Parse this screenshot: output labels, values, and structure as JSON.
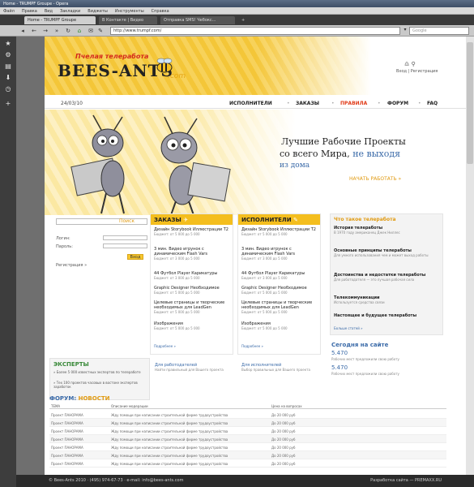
{
  "window": {
    "title": "Home - TRUMPF Groupe - Opera"
  },
  "menu": [
    "Файл",
    "Правка",
    "Вид",
    "Закладки",
    "Виджеты",
    "Инструменты",
    "Справка"
  ],
  "tabs": [
    {
      "label": "Home - TRUMPF Groupe"
    },
    {
      "label": "В Контакте | Видео"
    },
    {
      "label": "Отправка SMS! Чебокс..."
    }
  ],
  "address": {
    "url": "http://www.trumpf.com/",
    "search_placeholder": "Google"
  },
  "site": {
    "logo_small": "Пчелая телеработа",
    "logo_big": "BEES-ANTS",
    "logo_com": ".com",
    "util_icons": "♎ ⚲",
    "util_links": "Вход | Регистрация",
    "date": "24/03/10",
    "nav": [
      {
        "label": "ИСПОЛНИТЕЛИ",
        "active": false
      },
      {
        "label": "ЗАКАЗЫ",
        "active": false
      },
      {
        "label": "ПРАВИЛА",
        "active": true
      },
      {
        "label": "ФОРУМ",
        "active": false
      },
      {
        "label": "FAQ",
        "active": false
      }
    ],
    "hero": {
      "line1": "Лучшие Рабочие Проекты",
      "line2_a": "со всего Мира, ",
      "line2_b": "не выходя",
      "line3": "из дома",
      "cta": "НАЧАТЬ РАБОТАТЬ »"
    },
    "login": {
      "search_btn": "Поиск",
      "login_label": "Логин:",
      "password_label": "Пароль:",
      "submit": "Вход",
      "register": "Регистрация »"
    },
    "orders": {
      "title": "ЗАКАЗЫ",
      "items": [
        {
          "title": "Дизайн Storybook Иллюстрации Т2",
          "sub": "Бюджет: от 5 000 до 5 000"
        },
        {
          "title": "3 мин. Видео игрунок с динамическим Flash Vars",
          "sub": "Бюджет: от 3 000 до 5 000"
        },
        {
          "title": "44 Футбол Player Карикатуры",
          "sub": "Бюджет: от 3 000 до 5 000"
        },
        {
          "title": "Graphic Designer Необходимое",
          "sub": "Бюджет: от 5 000 до 5 000"
        },
        {
          "title": "Целевые страницы и творческие необходимых для LeadGen",
          "sub": "Бюджет: от 5 000 до 5 000"
        },
        {
          "title": "Изображения",
          "sub": "Бюджет: от 5 000 до 5 000"
        }
      ],
      "more": "Подробнее »"
    },
    "performers": {
      "title": "ИСПОЛНИТЕЛИ",
      "items": [
        {
          "title": "Дизайн Storybook Иллюстрации Т2",
          "sub": "Бюджет: от 5 000 до 5 000"
        },
        {
          "title": "3 мин. Видео игрунок с динамическим Flash Vars",
          "sub": "Бюджет: от 3 000 до 5 000"
        },
        {
          "title": "44 Футбол Player Карикатуры",
          "sub": "Бюджет: от 3 000 до 5 000"
        },
        {
          "title": "Graphic Designer Необходимое",
          "sub": "Бюджет: от 5 000 до 5 000"
        },
        {
          "title": "Целевые страницы и творческие необходимых для LeadGen",
          "sub": "Бюджет: от 5 000 до 5 000"
        },
        {
          "title": "Изображения",
          "sub": "Бюджет: от 5 000 до 5 000"
        }
      ],
      "more": "Подробнее »"
    },
    "telework": {
      "title": "Что такое телеработа",
      "items": [
        {
          "title": "История телеработы",
          "sub": "В 1970 году американец Джек Ниллес"
        },
        {
          "title": "Основные принципы телеработы",
          "sub": "Для умного использования чем и может выход работы"
        },
        {
          "title": "Достоинства и недостатки телеработы",
          "sub": "Для работодателя — это лучшая рабочая сила"
        },
        {
          "title": "Телекоммуникации",
          "sub": "Используется средства связи"
        },
        {
          "title": "Настоящее и будущее телеработы",
          "sub": ""
        }
      ],
      "more": "Больше статей »"
    },
    "today": {
      "title": "Сегодня на сайте",
      "stats": [
        {
          "num": "5.470",
          "text": "Рабочих мест предложили свою работу"
        },
        {
          "num": "5.470",
          "text": "Рабочих мест предложили свою работу"
        }
      ]
    },
    "experts": {
      "title": "ЭКСПЕРТЫ",
      "line1": "» Более 5 000 известных экспертов по телеработе",
      "line2": "» Тех 100 проектов часовых в востоке экспертов заработок"
    },
    "for_employers": {
      "title": "Для работодателей",
      "sub": "Найти правильный для Вашего проекта"
    },
    "for_performers": {
      "title": "Для исполнителей",
      "sub": "Выбор правильных для Вашего проекта"
    },
    "forum": {
      "title_a": "ФОРУМ: ",
      "title_b": "НОВОСТИ",
      "headers": [
        "ТЕМА",
        "Описание модерации",
        "Цена на вопросах"
      ],
      "rows": [
        [
          "Проект ПАНОРАМА",
          "Жду помощи при написании строительной фирме трудоустройства",
          "До 20 000 руб"
        ],
        [
          "Проект ПАНОРАМА",
          "Жду помощи при написании строительной фирме трудоустройства",
          "До 20 000 руб"
        ],
        [
          "Проект ПАНОРАМА",
          "Жду помощи при написании строительной фирме трудоустройства",
          "До 20 000 руб"
        ],
        [
          "Проект ПАНОРАМА",
          "Жду помощи при написании строительной фирме трудоустройства",
          "До 20 000 руб"
        ],
        [
          "Проект ПАНОРАМА",
          "Жду помощи при написании строительной фирме трудоустройства",
          "До 20 000 руб"
        ],
        [
          "Проект ПАНОРАМА",
          "Жду помощи при написании строительной фирме трудоустройства",
          "До 20 000 руб"
        ],
        [
          "Проект ПАНОРАМА",
          "Жду помощи при написании строительной фирме трудоустройства",
          "До 20 000 руб"
        ]
      ]
    }
  },
  "status": {
    "left": "© Bees-Ants 2010 · (495) 974-67-73 · e-mail: info@bees-ants.com",
    "right": "Разработка сайта — PREMAXX.RU"
  }
}
